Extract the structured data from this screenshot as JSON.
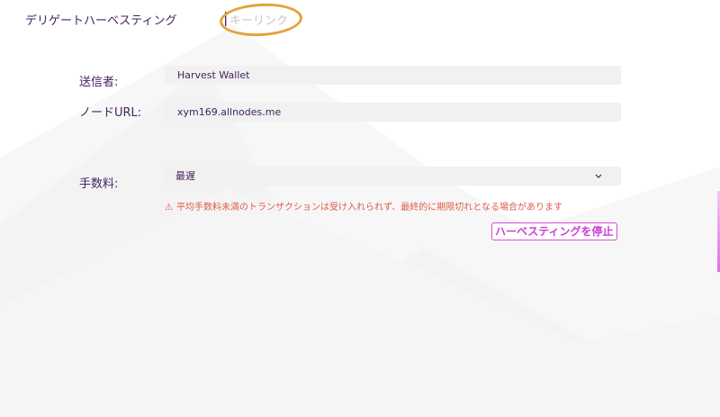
{
  "tabs": {
    "active_label": "デリゲートハーベスティング",
    "separator": "|",
    "inactive_label": "キーリンク"
  },
  "form": {
    "sender_label": "送信者:",
    "sender_value": "Harvest Wallet",
    "node_label": "ノードURL:",
    "node_value": "xym169.allnodes.me",
    "fee_label": "手数料:",
    "fee_value": "最遅"
  },
  "warning": {
    "icon": "⚠",
    "text": "平均手数料未満のトランザクションは受け入れられず、最終的に期限切れとなる場合があります"
  },
  "actions": {
    "stop_label": "ハーベスティングを停止"
  },
  "icons": {
    "chevron": "chevron-down-icon",
    "warning": "warning-triangle-icon"
  },
  "colors": {
    "text_primary": "#44235e",
    "warning": "#e05a4a",
    "button_accent": "#d84bd8",
    "annotation_circle": "#e3a23a"
  }
}
